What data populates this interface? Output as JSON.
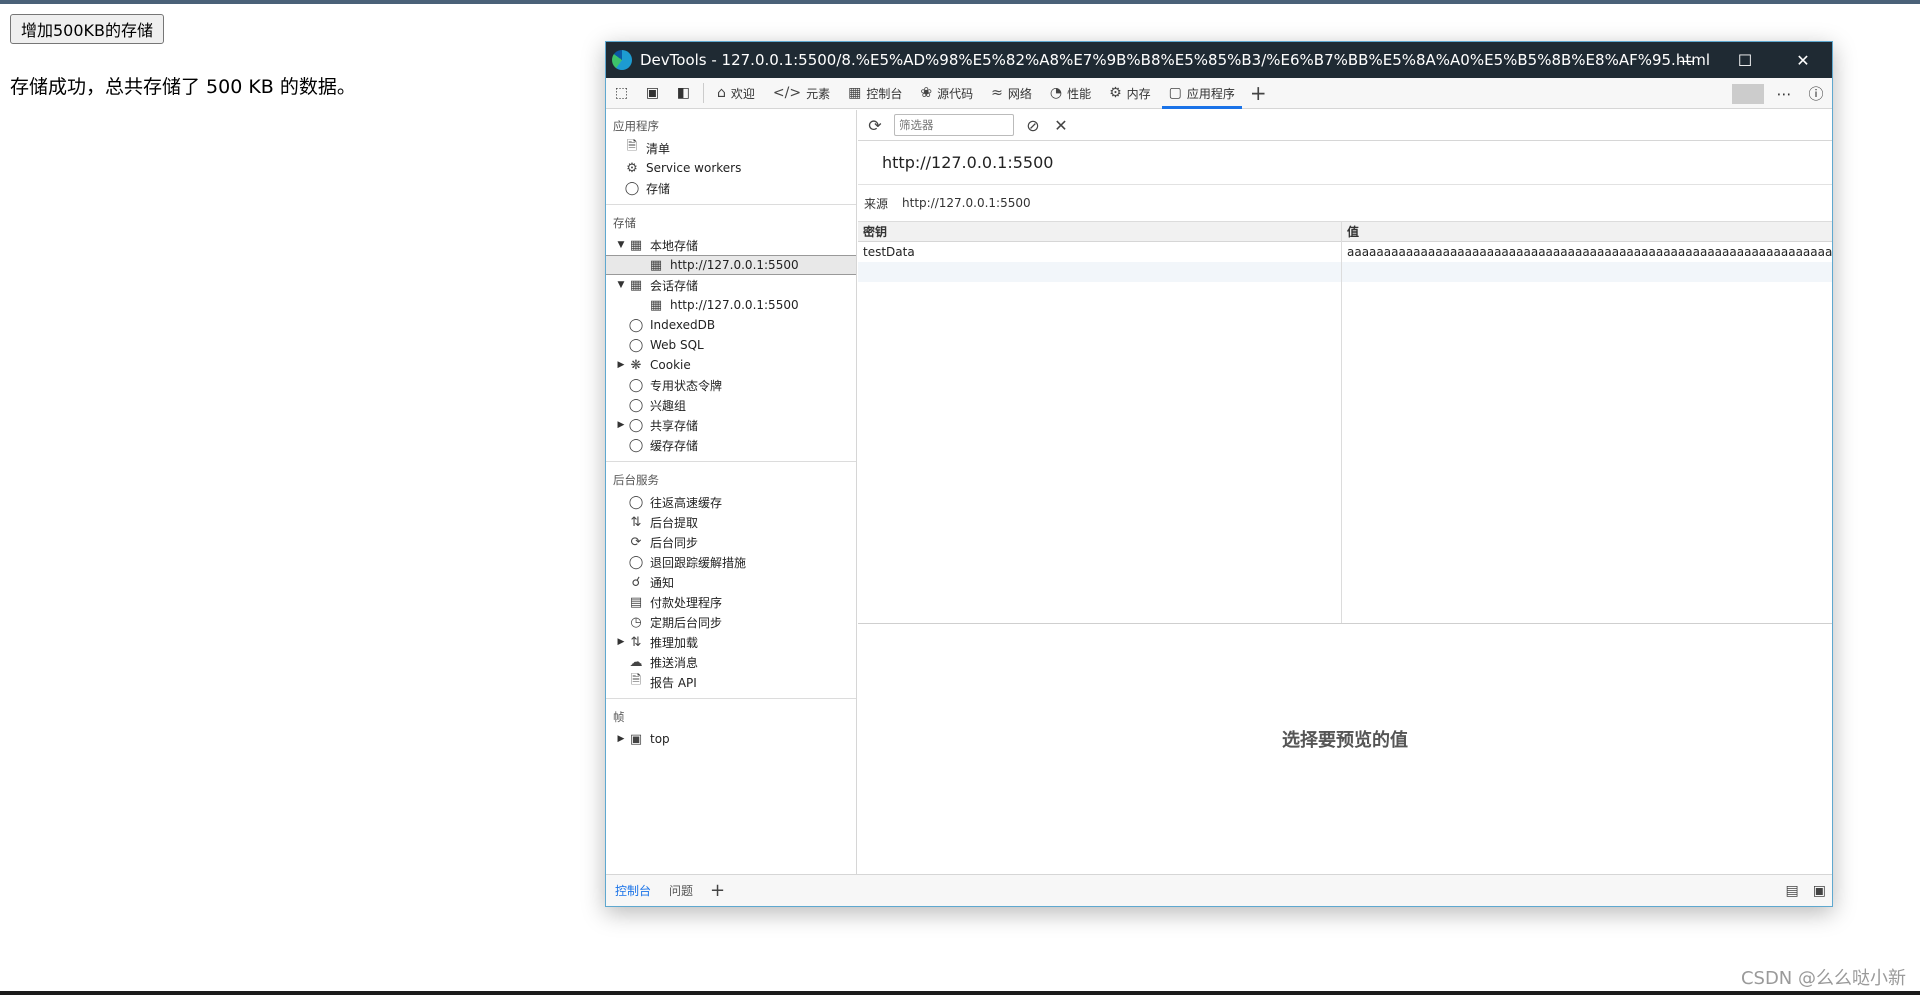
{
  "page": {
    "button_label": "增加500KB的存储",
    "message": "存储成功，总共存储了 500 KB 的数据。",
    "watermark": "CSDN @么么哒小新"
  },
  "window": {
    "title": "DevTools - 127.0.0.1:5500/8.%E5%AD%98%E5%82%A8%E7%9B%B8%E5%85%B3/%E6%B7%BB%E5%8A%A0%E5%B5%8B%E8%AF%95.html"
  },
  "tabs": [
    {
      "label": "欢迎",
      "icon": "home-icon"
    },
    {
      "label": "元素",
      "icon": "code-icon"
    },
    {
      "label": "控制台",
      "icon": "console-icon"
    },
    {
      "label": "源代码",
      "icon": "bug-icon"
    },
    {
      "label": "网络",
      "icon": "wifi-icon"
    },
    {
      "label": "性能",
      "icon": "gauge-icon"
    },
    {
      "label": "内存",
      "icon": "gear-icon"
    },
    {
      "label": "应用程序",
      "icon": "app-icon",
      "active": true
    }
  ],
  "sidebar": {
    "app_header": "应用程序",
    "app_items": [
      "清单",
      "Service workers",
      "存储"
    ],
    "storage_header": "存储",
    "local_storage": "本地存储",
    "local_storage_origin": "http://127.0.0.1:5500",
    "session_storage": "会话存储",
    "session_storage_origin": "http://127.0.0.1:5500",
    "indexeddb": "IndexedDB",
    "websql": "Web SQL",
    "cookie": "Cookie",
    "trust_tokens": "专用状态令牌",
    "interest_groups": "兴趣组",
    "shared_storage": "共享存储",
    "cache_storage": "缓存存储",
    "background_header": "后台服务",
    "bg_items": [
      "往返高速缓存",
      "后台提取",
      "后台同步",
      "退回跟踪缓解措施",
      "通知",
      "付款处理程序",
      "定期后台同步",
      "推理加载",
      "推送消息",
      "报告 API"
    ],
    "frames_header": "帧",
    "frame_top": "top"
  },
  "main": {
    "filter_placeholder": "筛选器",
    "origin_title": "http://127.0.0.1:5500",
    "origin_label": "来源",
    "origin_value": "http://127.0.0.1:5500",
    "col_key": "密钥",
    "col_value": "值",
    "rows": [
      {
        "key": "testData",
        "value": "aaaaaaaaaaaaaaaaaaaaaaaaaaaaaaaaaaaaaaaaaaaaaaaaaaaaaaaaaaaaaaaaaaaaaa..."
      }
    ],
    "preview_text": "选择要预览的值"
  },
  "drawer": {
    "tabs": [
      "控制台",
      "问题"
    ]
  }
}
